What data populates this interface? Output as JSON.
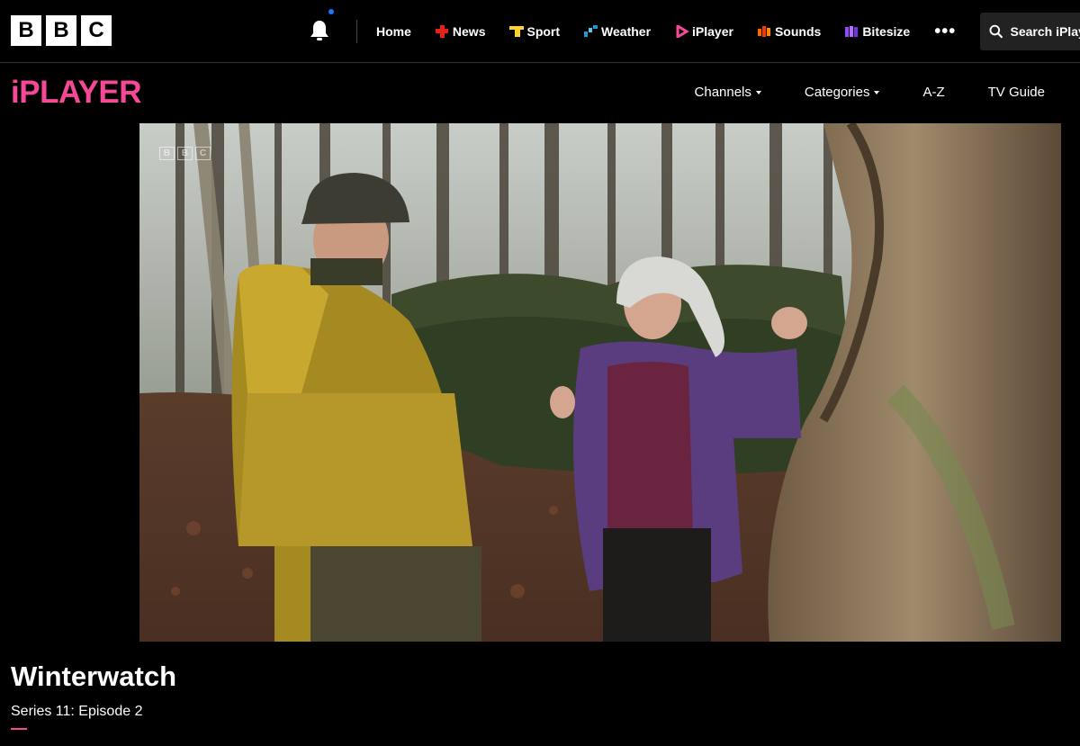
{
  "header": {
    "logo_letters": [
      "B",
      "B",
      "C"
    ],
    "nav": [
      {
        "label": "Home",
        "icon": "none",
        "color": ""
      },
      {
        "label": "News",
        "icon": "news-icon",
        "color": "#e62117"
      },
      {
        "label": "Sport",
        "icon": "sport-icon",
        "color": "#ffd230"
      },
      {
        "label": "Weather",
        "icon": "weather-icon",
        "color": "#1c9ad6"
      },
      {
        "label": "iPlayer",
        "icon": "iplayer-icon",
        "color": "#f54997"
      },
      {
        "label": "Sounds",
        "icon": "sounds-icon",
        "color": "#ff6600"
      },
      {
        "label": "Bitesize",
        "icon": "bitesize-icon",
        "color": "#9747ff"
      }
    ],
    "more_label": "•••",
    "search_label": "Search iPlayer"
  },
  "iplayer": {
    "logo": "iPLAYER",
    "nav": [
      {
        "label": "Channels",
        "dropdown": true
      },
      {
        "label": "Categories",
        "dropdown": true
      },
      {
        "label": "A-Z",
        "dropdown": false
      },
      {
        "label": "TV Guide",
        "dropdown": false
      }
    ]
  },
  "video": {
    "watermark": [
      "B",
      "B",
      "C"
    ]
  },
  "programme": {
    "title": "Winterwatch",
    "episode": "Series 11: Episode 2"
  },
  "colors": {
    "accent": "#f54997",
    "background": "#000000"
  }
}
